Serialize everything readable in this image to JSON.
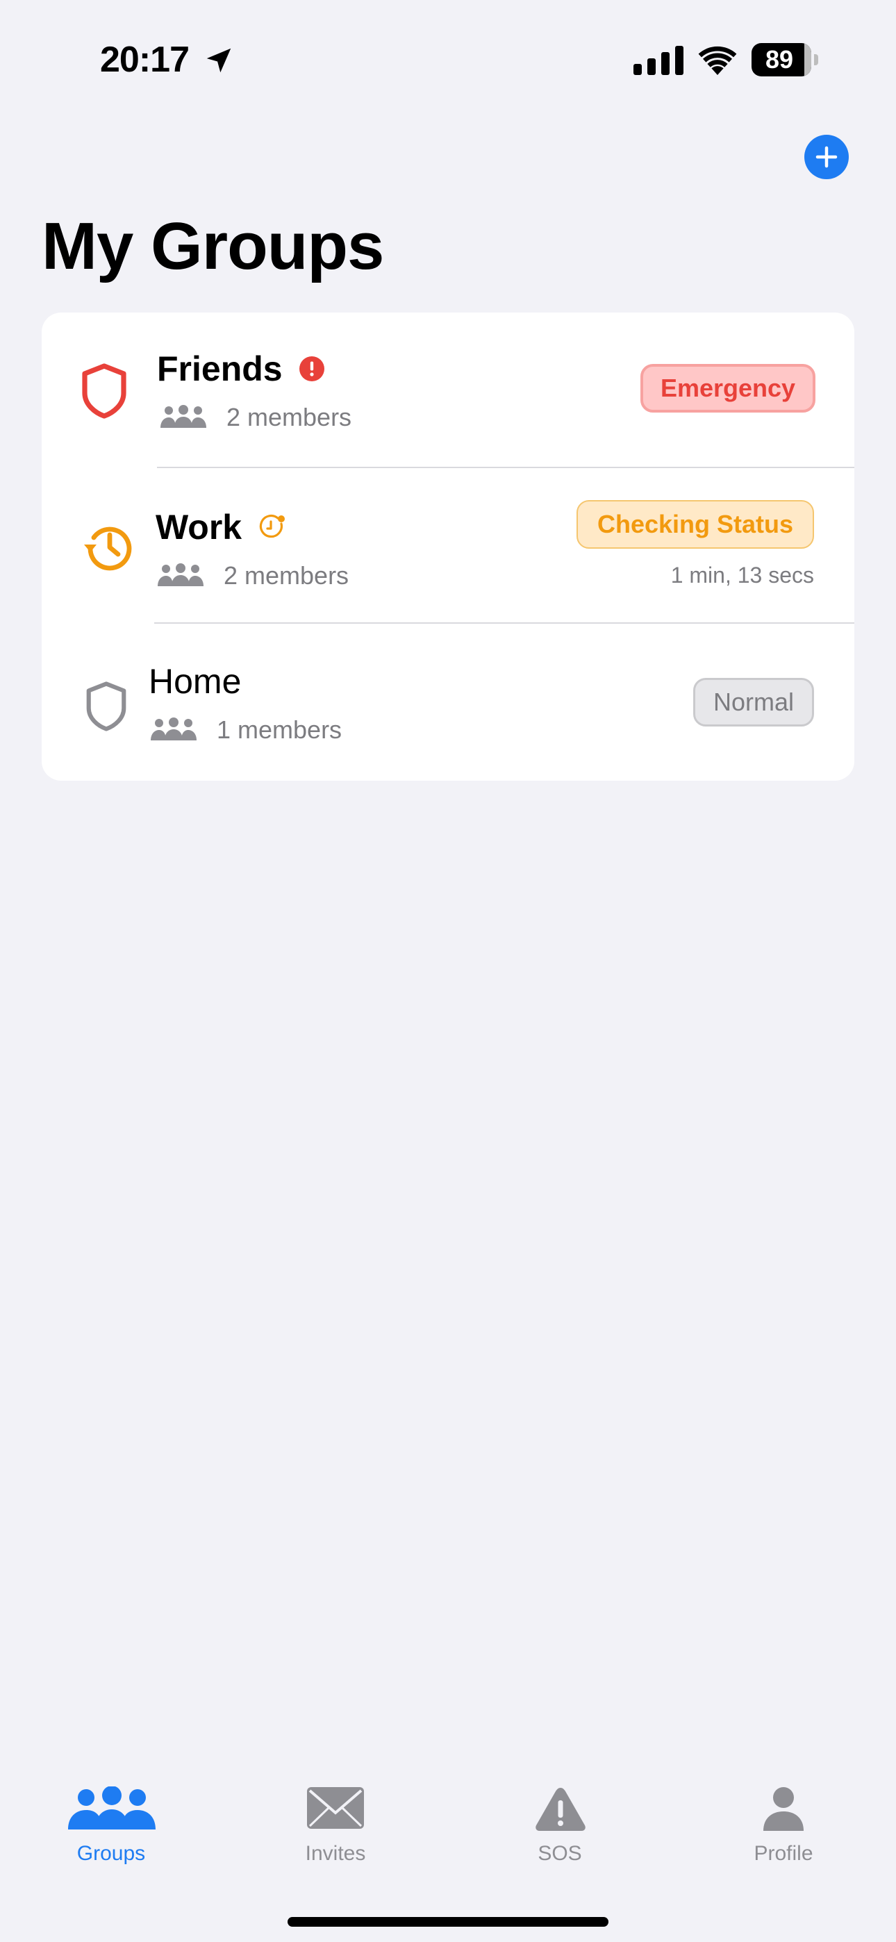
{
  "status_bar": {
    "time": "20:17",
    "battery": "89"
  },
  "header": {
    "title": "My Groups",
    "add_icon": "plus-circle-icon"
  },
  "groups": [
    {
      "name": "Friends",
      "members": "2 members",
      "status": "Emergency",
      "status_color": "#E8413A",
      "icon": "shield-icon",
      "indicator_icon": "exclamation-circle-icon"
    },
    {
      "name": "Work",
      "members": "2 members",
      "status": "Checking Status",
      "status_color": "#F29A0F",
      "elapsed": "1 min, 13 secs",
      "icon": "clock-history-icon",
      "indicator_icon": "timer-icon"
    },
    {
      "name": "Home",
      "members": "1 members",
      "status": "Normal",
      "status_color": "#8E8E93",
      "icon": "shield-icon"
    }
  ],
  "tabs": [
    {
      "label": "Groups",
      "icon": "people-icon",
      "active": true
    },
    {
      "label": "Invites",
      "icon": "envelope-icon",
      "active": false
    },
    {
      "label": "SOS",
      "icon": "warning-triangle-icon",
      "active": false
    },
    {
      "label": "Profile",
      "icon": "person-icon",
      "active": false
    }
  ],
  "colors": {
    "accent": "#1E7CF2",
    "background": "#F2F2F7",
    "emergency": "#E8413A",
    "checking": "#F29A0F"
  }
}
